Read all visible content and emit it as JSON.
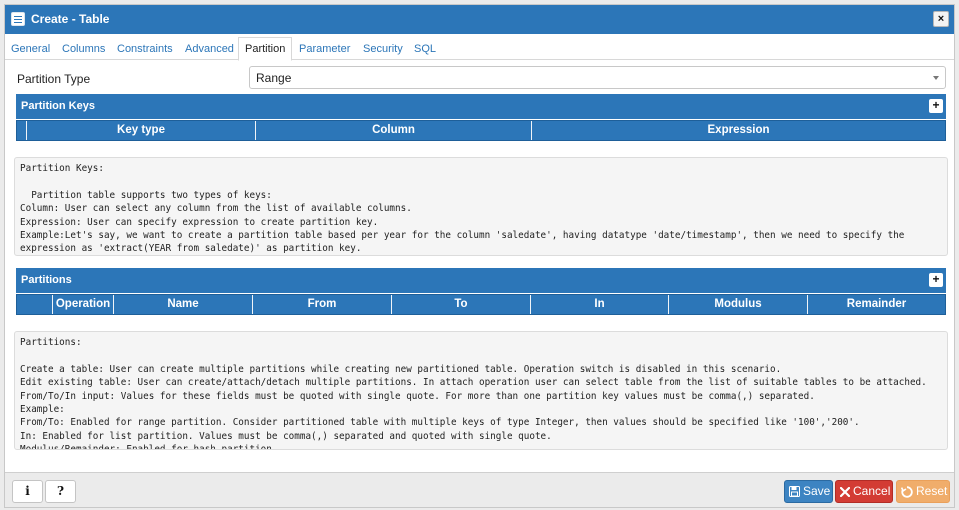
{
  "dialog": {
    "title": "Create - Table",
    "close_label": "×"
  },
  "tabs": [
    "General",
    "Columns",
    "Constraints",
    "Advanced",
    "Partition",
    "Parameter",
    "Security",
    "SQL"
  ],
  "active_tab": "Partition",
  "partition_type": {
    "label": "Partition Type",
    "value": "Range"
  },
  "partition_keys": {
    "title": "Partition Keys",
    "add_label": "+",
    "columns": [
      "Key type",
      "Column",
      "Expression"
    ],
    "help": "Partition Keys:\n\n  Partition table supports two types of keys:\nColumn: User can select any column from the list of available columns.\nExpression: User can specify expression to create partition key.\nExample:Let's say, we want to create a partition table based per year for the column 'saledate', having datatype 'date/timestamp', then we need to specify the\nexpression as 'extract(YEAR from saledate)' as partition key."
  },
  "partitions": {
    "title": "Partitions",
    "add_label": "+",
    "columns": [
      "Operation",
      "Name",
      "From",
      "To",
      "In",
      "Modulus",
      "Remainder"
    ],
    "help": "Partitions:\n\nCreate a table: User can create multiple partitions while creating new partitioned table. Operation switch is disabled in this scenario.\nEdit existing table: User can create/attach/detach multiple partitions. In attach operation user can select table from the list of suitable tables to be attached.\nFrom/To/In input: Values for these fields must be quoted with single quote. For more than one partition key values must be comma(,) separated.\nExample:\nFrom/To: Enabled for range partition. Consider partitioned table with multiple keys of type Integer, then values should be specified like '100','200'.\nIn: Enabled for list partition. Values must be comma(,) separated and quoted with single quote.\nModulus/Remainder: Enabled for hash partition."
  },
  "footer": {
    "info_label": "i",
    "help_label": "?",
    "save_label": "Save",
    "cancel_label": "Cancel",
    "reset_label": "Reset"
  },
  "colors": {
    "header_blue": "#2c76b8",
    "cancel_red": "#d33c34",
    "reset_orange": "#f0ad6b"
  }
}
